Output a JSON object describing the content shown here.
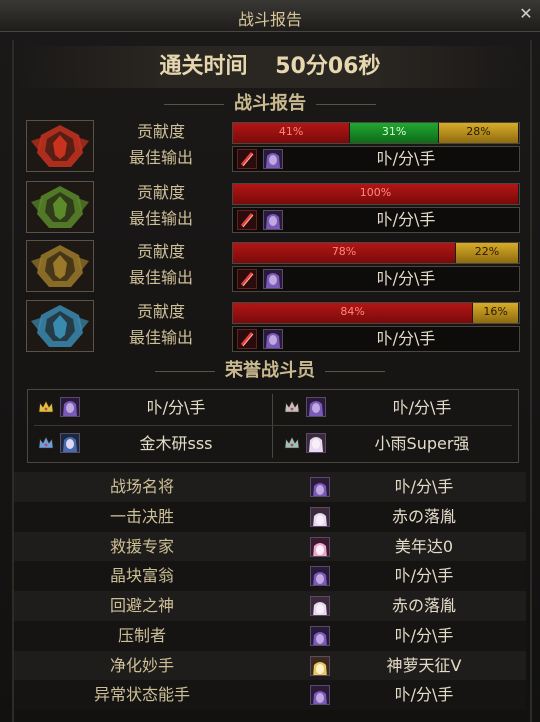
{
  "window": {
    "title": "战斗报告",
    "close_glyph": "✕"
  },
  "clear_time": {
    "label": "通关时间",
    "value": "50分06秒"
  },
  "battle_report": {
    "heading": "战斗报告",
    "contribution_label": "贡献度",
    "best_output_label": "最佳输出",
    "teams": [
      {
        "emblem_color": "#c8321e",
        "segments": [
          {
            "percent": 41,
            "label": "41%",
            "color": "red"
          },
          {
            "percent": 31,
            "label": "31%",
            "color": "green"
          },
          {
            "percent": 28,
            "label": "28%",
            "color": "gold"
          }
        ],
        "best_player": "卟/分\\手"
      },
      {
        "emblem_color": "#5a8a2a",
        "segments": [
          {
            "percent": 100,
            "label": "100%",
            "color": "red"
          }
        ],
        "best_player": "卟/分\\手"
      },
      {
        "emblem_color": "#9a7a2a",
        "segments": [
          {
            "percent": 78,
            "label": "78%",
            "color": "red"
          },
          {
            "percent": 22,
            "label": "22%",
            "color": "gold"
          }
        ],
        "best_player": "卟/分\\手"
      },
      {
        "emblem_color": "#3a8ab0",
        "segments": [
          {
            "percent": 84,
            "label": "84%",
            "color": "red"
          },
          {
            "percent": 16,
            "label": "16%",
            "color": "gold"
          }
        ],
        "best_player": "卟/分\\手"
      }
    ]
  },
  "honor": {
    "heading": "荣誉战斗员",
    "members": [
      {
        "name": "卟/分\\手",
        "crown_color": "#e0c040",
        "avatar": "purple"
      },
      {
        "name": "卟/分\\手",
        "crown_color": "#c0c0c8",
        "avatar": "purple"
      },
      {
        "name": "金木研sss",
        "crown_color": "#6aa0e0",
        "avatar": "blue"
      },
      {
        "name": "小雨Super强",
        "crown_color": "#9ac0c0",
        "avatar": "light"
      }
    ]
  },
  "awards": [
    {
      "title": "战场名将",
      "player": "卟/分\\手",
      "avatar": "purple"
    },
    {
      "title": "一击决胜",
      "player": "赤の落胤",
      "avatar": "light"
    },
    {
      "title": "救援专家",
      "player": "美年达0",
      "avatar": "pink"
    },
    {
      "title": "晶块富翁",
      "player": "卟/分\\手",
      "avatar": "purple"
    },
    {
      "title": "回避之神",
      "player": "赤の落胤",
      "avatar": "light"
    },
    {
      "title": "压制者",
      "player": "卟/分\\手",
      "avatar": "purple"
    },
    {
      "title": "净化妙手",
      "player": "神萝天征V",
      "avatar": "blonde"
    },
    {
      "title": "异常状态能手",
      "player": "卟/分\\手",
      "avatar": "purple"
    }
  ]
}
